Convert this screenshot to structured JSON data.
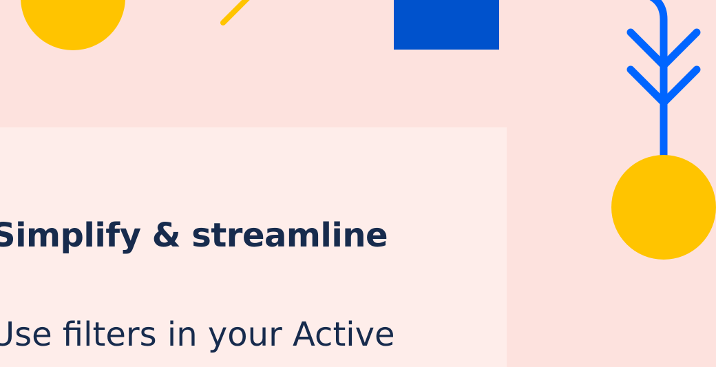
{
  "content": {
    "title": "Simplify & streamline",
    "body": "Use filters in your Active"
  },
  "colors": {
    "page_background": "#fde2de",
    "card_background": "#feedea",
    "text": "#172b4d",
    "yellow_accent": "#ffc400",
    "blue_accent": "#0052cc",
    "bright_blue_accent": "#0065ff"
  },
  "decorations": [
    "yellow-circle",
    "yellow-line",
    "blue-square",
    "blue-arrow",
    "yellow-circle"
  ]
}
